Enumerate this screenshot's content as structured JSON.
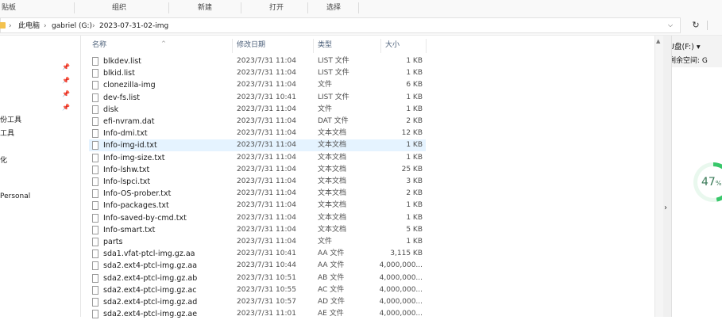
{
  "ribbon": {
    "groups": [
      "贴板",
      "组织",
      "新建",
      "打开",
      "选择"
    ]
  },
  "address": {
    "crumbs": [
      "此电脑",
      "gabriel (G:)",
      "2023-07-31-02-img"
    ],
    "dropdown_icon": "chevron-down-icon",
    "refresh_icon": "refresh-icon"
  },
  "nav": {
    "items": [
      "份工具",
      "工具",
      "化",
      "Personal"
    ]
  },
  "columns": {
    "name": "名称",
    "date": "修改日期",
    "type": "类型",
    "size": "大小"
  },
  "files": [
    {
      "name": "blkdev.list",
      "date": "2023/7/31 11:04",
      "type": "LIST 文件",
      "size": "1 KB"
    },
    {
      "name": "blkid.list",
      "date": "2023/7/31 11:04",
      "type": "LIST 文件",
      "size": "1 KB"
    },
    {
      "name": "clonezilla-img",
      "date": "2023/7/31 11:04",
      "type": "文件",
      "size": "6 KB"
    },
    {
      "name": "dev-fs.list",
      "date": "2023/7/31 10:41",
      "type": "LIST 文件",
      "size": "1 KB"
    },
    {
      "name": "disk",
      "date": "2023/7/31 11:04",
      "type": "文件",
      "size": "1 KB"
    },
    {
      "name": "efi-nvram.dat",
      "date": "2023/7/31 11:04",
      "type": "DAT 文件",
      "size": "2 KB"
    },
    {
      "name": "Info-dmi.txt",
      "date": "2023/7/31 11:04",
      "type": "文本文档",
      "size": "12 KB"
    },
    {
      "name": "Info-img-id.txt",
      "date": "2023/7/31 11:04",
      "type": "文本文档",
      "size": "1 KB",
      "selected": true
    },
    {
      "name": "Info-img-size.txt",
      "date": "2023/7/31 11:04",
      "type": "文本文档",
      "size": "1 KB"
    },
    {
      "name": "Info-lshw.txt",
      "date": "2023/7/31 11:04",
      "type": "文本文档",
      "size": "25 KB"
    },
    {
      "name": "Info-lspci.txt",
      "date": "2023/7/31 11:04",
      "type": "文本文档",
      "size": "3 KB"
    },
    {
      "name": "Info-OS-prober.txt",
      "date": "2023/7/31 11:04",
      "type": "文本文档",
      "size": "2 KB"
    },
    {
      "name": "Info-packages.txt",
      "date": "2023/7/31 11:04",
      "type": "文本文档",
      "size": "1 KB"
    },
    {
      "name": "Info-saved-by-cmd.txt",
      "date": "2023/7/31 11:04",
      "type": "文本文档",
      "size": "1 KB"
    },
    {
      "name": "Info-smart.txt",
      "date": "2023/7/31 11:04",
      "type": "文本文档",
      "size": "5 KB"
    },
    {
      "name": "parts",
      "date": "2023/7/31 11:04",
      "type": "文件",
      "size": "1 KB"
    },
    {
      "name": "sda1.vfat-ptcl-img.gz.aa",
      "date": "2023/7/31 10:41",
      "type": "AA 文件",
      "size": "3,115 KB"
    },
    {
      "name": "sda2.ext4-ptcl-img.gz.aa",
      "date": "2023/7/31 10:44",
      "type": "AA 文件",
      "size": "4,000,000..."
    },
    {
      "name": "sda2.ext4-ptcl-img.gz.ab",
      "date": "2023/7/31 10:51",
      "type": "AB 文件",
      "size": "4,000,000..."
    },
    {
      "name": "sda2.ext4-ptcl-img.gz.ac",
      "date": "2023/7/31 10:55",
      "type": "AC 文件",
      "size": "4,000,000..."
    },
    {
      "name": "sda2.ext4-ptcl-img.gz.ad",
      "date": "2023/7/31 10:57",
      "type": "AD 文件",
      "size": "4,000,000..."
    },
    {
      "name": "sda2.ext4-ptcl-img.gz.ae",
      "date": "2023/7/31 11:01",
      "type": "AE 文件",
      "size": "4,000,000..."
    }
  ],
  "details": {
    "drive": "U盘(F:) ▾",
    "free_label": "剩余空间: G"
  },
  "gauge": {
    "percent": 47,
    "value_text": "47",
    "unit": "%",
    "color": "#38c76a"
  },
  "colors": {
    "selected_row": "#e5f3ff",
    "folder": "#f3c24f"
  }
}
